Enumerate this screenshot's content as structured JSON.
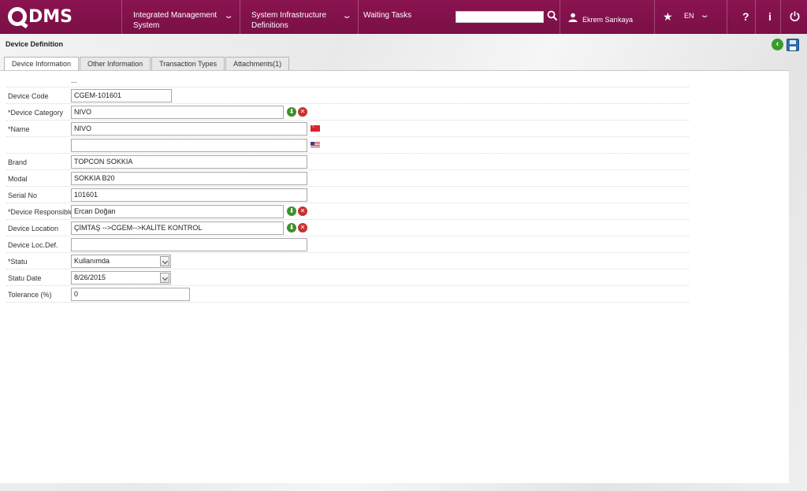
{
  "app": {
    "logo_text": "DMS"
  },
  "nav": {
    "items": [
      {
        "label_line1": "Integrated Management",
        "label_line2": "System"
      },
      {
        "label_line1": "System Infrastructure",
        "label_line2": "Definitions"
      },
      {
        "label_line1": "Waiting Tasks",
        "label_line2": ""
      }
    ],
    "chevron": "❯"
  },
  "search": {
    "value": "",
    "placeholder": ""
  },
  "user": {
    "name": "Ekrem Sarıkaya"
  },
  "lang": {
    "code": "EN"
  },
  "header_icons": {
    "help": "?",
    "info": "i"
  },
  "page": {
    "title": "Device Definition"
  },
  "tabs": [
    {
      "label": "Device Information",
      "active": true
    },
    {
      "label": "Other Information",
      "active": false
    },
    {
      "label": "Transaction Types",
      "active": false
    },
    {
      "label": "Attachments(1)",
      "active": false
    }
  ],
  "form": {
    "dots": "...",
    "device_code": {
      "label": "Device Code",
      "value": "CGEM-101601"
    },
    "device_category": {
      "label": "*Device Category",
      "value": "NIVO"
    },
    "name": {
      "label": "*Name",
      "value": "NIVO"
    },
    "name_en": {
      "label": "",
      "value": ""
    },
    "brand": {
      "label": "Brand",
      "value": "TOPCON SOKKIA"
    },
    "modal": {
      "label": "Modal",
      "value": "SOKKIA B20"
    },
    "serial_no": {
      "label": "Serial No",
      "value": "101601"
    },
    "device_responsible": {
      "label": "*Device Responsible",
      "value": "Ercan Doğan"
    },
    "device_location": {
      "label": "Device Location",
      "value": "ÇİMTAŞ -->CGEM-->KALİTE KONTROL"
    },
    "device_loc_def": {
      "label": "Device Loc.Def.",
      "value": ""
    },
    "statu": {
      "label": "*Statu",
      "value": "Kullanımda"
    },
    "statu_date": {
      "label": "Statu Date",
      "value": "8/26/2015"
    },
    "tolerance": {
      "label": "Tolerance (%)",
      "value": "0"
    }
  },
  "colors": {
    "topbar": "#8a1450",
    "ok": "#3f8f2e",
    "delete": "#c8312f",
    "back": "#3a9b2c"
  }
}
